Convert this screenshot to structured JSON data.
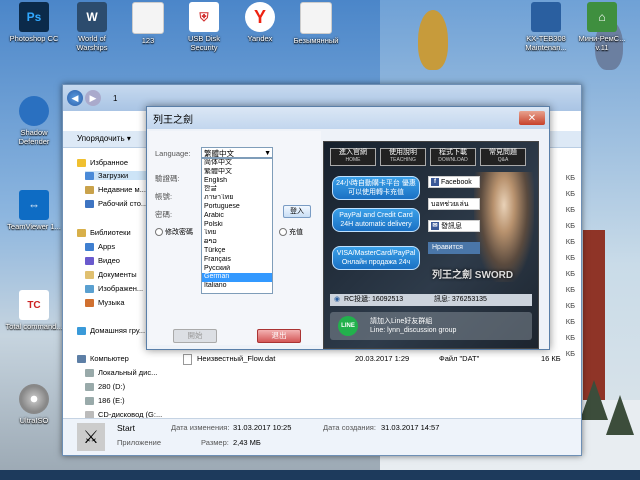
{
  "desktop": {
    "icons": [
      {
        "label": "Photoshop CC",
        "glyph": "Ps",
        "color": "#0b2a4a"
      },
      {
        "label": "World of Warships",
        "glyph": "W",
        "color": "#2c4c6e"
      },
      {
        "label": "123",
        "glyph": "",
        "color": "#f4f4f4"
      },
      {
        "label": "USB Disk Security",
        "glyph": "U",
        "color": "#d23232"
      },
      {
        "label": "Yandex",
        "glyph": "Y",
        "color": "#ffffff"
      },
      {
        "label": "Безымянный",
        "glyph": "",
        "color": "#f4f4f4"
      },
      {
        "label": "KX-TEB308 Maintenan...",
        "glyph": "",
        "color": "#2a5fa0"
      },
      {
        "label": "Мини-РемС... v.11",
        "glyph": "",
        "color": "#3f8f3f"
      },
      {
        "label": "Shadow Defender",
        "glyph": "",
        "color": "#2a70c0"
      },
      {
        "label": "TeamViewer 1...",
        "glyph": "⇔",
        "color": "#0e6cc4"
      },
      {
        "label": "Total command...",
        "glyph": "TC",
        "color": "#c22"
      },
      {
        "label": "UltraISO",
        "glyph": "",
        "color": "#888"
      }
    ]
  },
  "explorer": {
    "address": "1",
    "toolbar_organize": "Упорядочить ▾",
    "nav": {
      "favorites": "Избранное",
      "downloads": "Загрузки",
      "recent": "Недавние м...",
      "desktop": "Рабочий сто...",
      "libraries": "Библиотеки",
      "apps": "Apps",
      "video": "Видео",
      "documents": "Документы",
      "images": "Изображен...",
      "music": "Музыка",
      "homegroup": "Домашняя гру...",
      "computer": "Компьютер",
      "local_disk": "Локальный дис...",
      "drive_d": "280 (D:)",
      "drive_e": "186 (E:)",
      "cd_drive": "CD-дисковод (G:..."
    },
    "size_column": [
      "КБ",
      "КБ",
      "КБ",
      "КБ",
      "КБ",
      "КБ",
      "КБ",
      "КБ",
      "КБ",
      "КБ",
      "КБ",
      "КБ",
      "КБ"
    ],
    "file": {
      "name": "Неизвестный_Flow.dat",
      "date": "20.03.2017 1:29",
      "type": "Файл \"DAT\"",
      "size": "16 КБ"
    },
    "details": {
      "name": "Start",
      "type": "Приложение",
      "modified_label": "Дата изменения:",
      "modified_value": "31.03.2017 10:25",
      "size_label": "Размер:",
      "size_value": "2,43 МБ",
      "created_label": "Дата создания:",
      "created_value": "31.03.2017 14:57"
    }
  },
  "dialog": {
    "title": "列王之劍",
    "close": "✕",
    "language_label": "Language:",
    "language_selected": "繁體中文",
    "languages": [
      "简体中文",
      "繁體中文",
      "English",
      "한글",
      "ภาษาไทย",
      "Portuguese",
      "Arabic",
      "Polski",
      "ไทย",
      "ລາວ",
      "Türkçe",
      "Français",
      "Русский",
      "German",
      "Italiano"
    ],
    "highlighted_language": "German",
    "server_label": "驗證碼:",
    "account_label": "帳號:",
    "password_label": "密碼:",
    "login_button": "登入",
    "remember": "修改密碼",
    "recharge": "充值",
    "start_button": "開始",
    "exit_button": "退出"
  },
  "promo": {
    "tabs": [
      {
        "label": "進入官網",
        "sub": "HOME"
      },
      {
        "label": "使用說明",
        "sub": "TEACHING"
      },
      {
        "label": "程式下載",
        "sub": "DOWNLOAD"
      },
      {
        "label": "常見問題",
        "sub": "Q&A"
      }
    ],
    "bubble1": "24小時自動購卡平台 優惠可以使用轉卡充值",
    "bubble2": "PayPal and Credit Card 24H automatic delivery",
    "bubble3": "VISA/MasterCard/PayPal Онлайн продажа 24ч",
    "facebook": "Facebook",
    "thai": "บอทช่วยเล่น",
    "info": "發訊息",
    "vk": "Нравится",
    "logo": "列王之劍 SWORD",
    "qq_label": "RC投遞: 16092513",
    "qq_label2": "訊息: 376253135",
    "line_text1": "請加入Line好友群組",
    "line_text2": "Line: lynn_discussion group",
    "line_icon": "LINE"
  }
}
